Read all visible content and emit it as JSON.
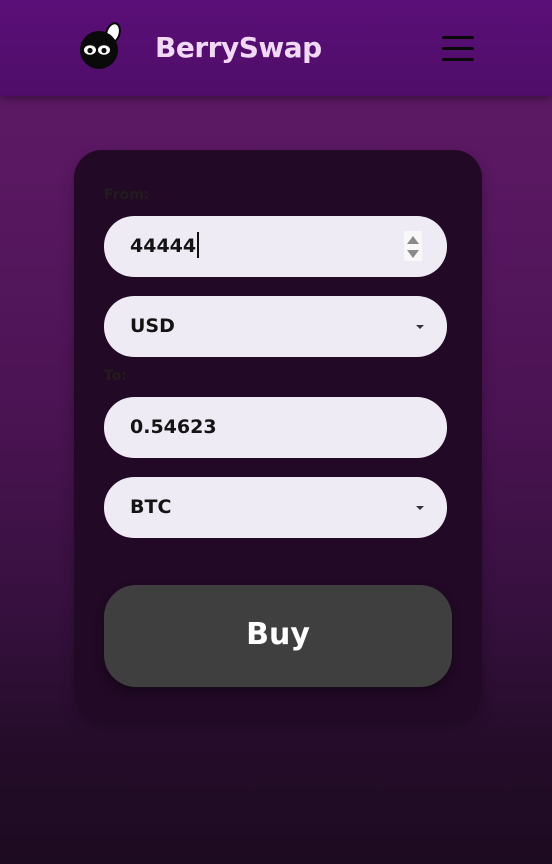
{
  "header": {
    "brand": "BerrySwap",
    "logo_icon": "berry-mascot-icon",
    "menu_icon": "hamburger-menu-icon",
    "background_color": "#5a0f78",
    "brand_color": "#f1d8f4"
  },
  "converter": {
    "from_label": "From:",
    "amount_value": "44444",
    "from_currency": "USD",
    "to_label": "To:",
    "result_value": "0.54623",
    "to_currency": "BTC",
    "buy_label": "Buy",
    "card_color": "#220926",
    "field_color": "#efebf4",
    "button_color": "#3f3f3f"
  }
}
